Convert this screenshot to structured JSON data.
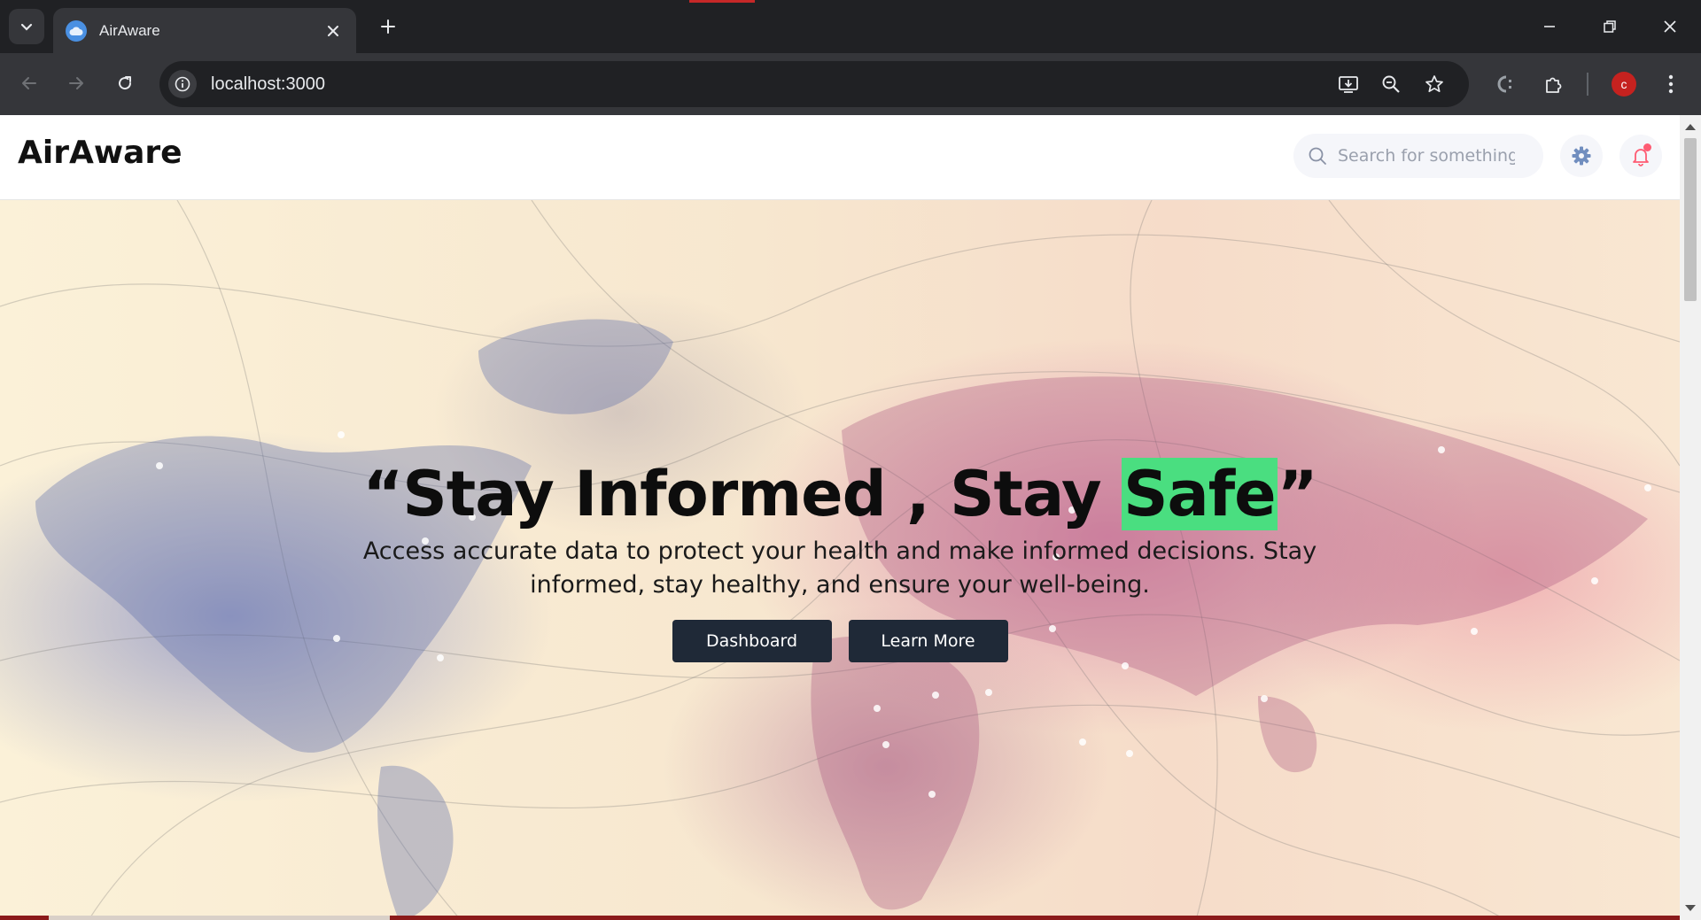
{
  "browser": {
    "tab_title": "AirAware",
    "url": "localhost:3000",
    "profile_initial": "c"
  },
  "app": {
    "brand": "AirAware",
    "search_placeholder": "Search for something..",
    "accent_color": "#4ade80",
    "button_color": "#1f2937"
  },
  "hero": {
    "headline_open": "“Stay Informed , Stay ",
    "headline_highlight": "Safe",
    "headline_close": "”",
    "subtitle": "Access accurate data to protect your health and make informed decisions. Stay informed, stay healthy, and ensure your well-being.",
    "primary_button": "Dashboard",
    "secondary_button": "Learn More"
  }
}
